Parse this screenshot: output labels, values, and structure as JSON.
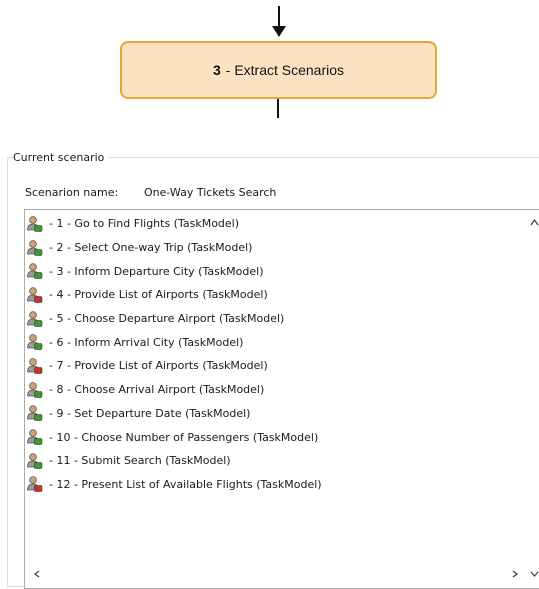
{
  "diagram": {
    "step_number": "3",
    "step_label": "- Extract Scenarios"
  },
  "current_scenario": {
    "group_title": "Current scenario",
    "name_label": "Scenarion name:",
    "name_value": "One-Way Tickets Search",
    "items": [
      {
        "label": "- 1 - Go to Find Flights (TaskModel)",
        "icon": "user-task-icon",
        "accent": "#3c9a2f"
      },
      {
        "label": "- 2 - Select One-way Trip (TaskModel)",
        "icon": "user-task-icon",
        "accent": "#3c9a2f"
      },
      {
        "label": "- 3 - Inform Departure City (TaskModel)",
        "icon": "user-task-icon",
        "accent": "#3c9a2f"
      },
      {
        "label": "- 4 - Provide List of Airports (TaskModel)",
        "icon": "system-task-icon",
        "accent": "#c8322b"
      },
      {
        "label": "- 5 - Choose Departure Airport (TaskModel)",
        "icon": "user-task-icon",
        "accent": "#3c9a2f"
      },
      {
        "label": "- 6 - Inform Arrival City (TaskModel)",
        "icon": "user-task-icon",
        "accent": "#3c9a2f"
      },
      {
        "label": "- 7 - Provide List of Airports (TaskModel)",
        "icon": "system-task-icon",
        "accent": "#c8322b"
      },
      {
        "label": "- 8 - Choose Arrival Airport (TaskModel)",
        "icon": "user-task-icon",
        "accent": "#3c9a2f"
      },
      {
        "label": "- 9 - Set Departure Date (TaskModel)",
        "icon": "user-task-icon",
        "accent": "#3c9a2f"
      },
      {
        "label": "- 10 - Choose Number of Passengers (TaskModel)",
        "icon": "user-task-icon",
        "accent": "#3c9a2f"
      },
      {
        "label": "- 11 - Submit Search (TaskModel)",
        "icon": "user-task-icon",
        "accent": "#3c9a2f"
      },
      {
        "label": "- 12 - Present List of Available Flights (TaskModel)",
        "icon": "system-task-icon",
        "accent": "#c8322b"
      }
    ]
  },
  "colors": {
    "step_fill": "#fbe2c2",
    "step_border": "#e2a938",
    "user_task": "#3c9a2f",
    "system_task": "#c8322b"
  }
}
